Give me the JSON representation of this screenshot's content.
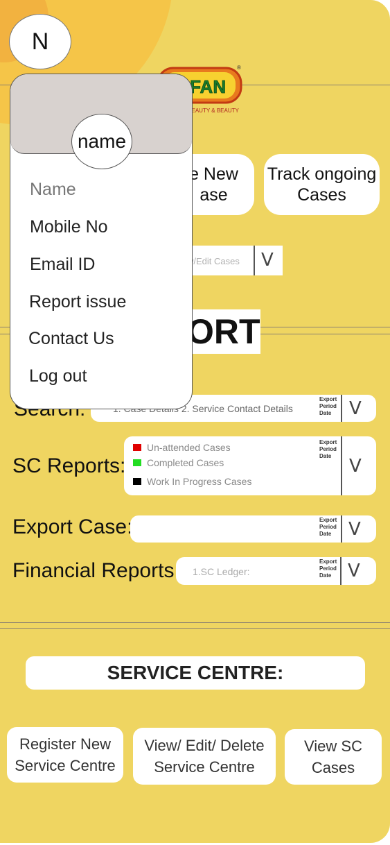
{
  "header": {
    "avatar_initial": "N",
    "logo_text": "OFAN",
    "logo_tagline": "BEAUTY & BEAUTY"
  },
  "actions": {
    "create_new_case": "e New\nase",
    "track_ongoing": "Track ongoing\nCases",
    "view_edit_cases": "w/Edit Cases",
    "chevron": "V"
  },
  "report": {
    "title": "ORT",
    "export_tag": "Export\nPeriod\nDate",
    "search_label": "Search:",
    "search_options": "1. Case Details   2. Service Contact Details",
    "sc_reports_label": "SC Reports:",
    "sc_legend": [
      {
        "label": "Un-attended Cases",
        "color": "#e00000"
      },
      {
        "label": "Completed Cases",
        "color": "#22dd22"
      },
      {
        "label": "Work In Progress Cases",
        "color": "#000000"
      }
    ],
    "export_case_label": "Export Case:",
    "financial_label": "Financial Reports:",
    "financial_option": "1.SC Ledger:"
  },
  "service_centre": {
    "title": "SERVICE CENTRE:",
    "register": "Register New\nService Centre",
    "view_edit_delete": "View/ Edit/ Delete\nService Centre",
    "view_cases": "View  SC\nCases"
  },
  "profile_menu": {
    "avatar_label": "name",
    "items": [
      "Name",
      "Mobile No",
      "Email ID",
      "Report issue",
      "Contact Us",
      "Log out"
    ]
  }
}
